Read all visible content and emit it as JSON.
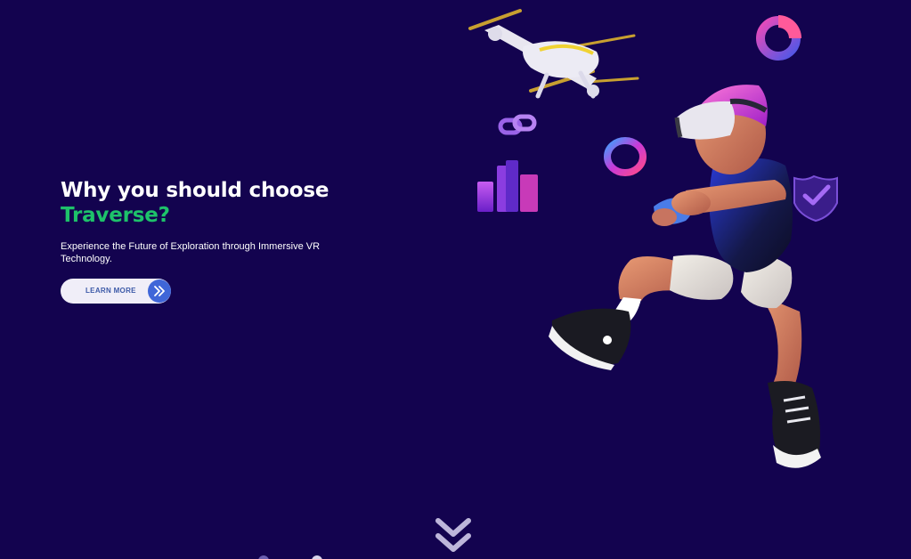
{
  "hero": {
    "headline_line1": "Why you should choose",
    "headline_accent": "Traverse?",
    "subtext": "Experience the Future of Exploration through Immersive VR Technology.",
    "cta_label": "LEARN MORE",
    "cta_icon": "double-chevron-right-icon"
  },
  "illustration": {
    "subject": "vr-player-with-controller",
    "decorations": [
      "drone",
      "donut-chart-icon",
      "link-icon",
      "ring-icon",
      "bar-chart-icon",
      "shield-check-icon"
    ]
  },
  "scroll_indicator": {
    "icon": "double-chevron-down-icon"
  },
  "colors": {
    "background": "#13034f",
    "headline": "#ffffff",
    "accent": "#1ec26a",
    "button_bg": "#f0eef8",
    "button_text": "#3d5aa8",
    "button_icon_bg": "#3f66d8",
    "chevron": "#bdb6da"
  }
}
